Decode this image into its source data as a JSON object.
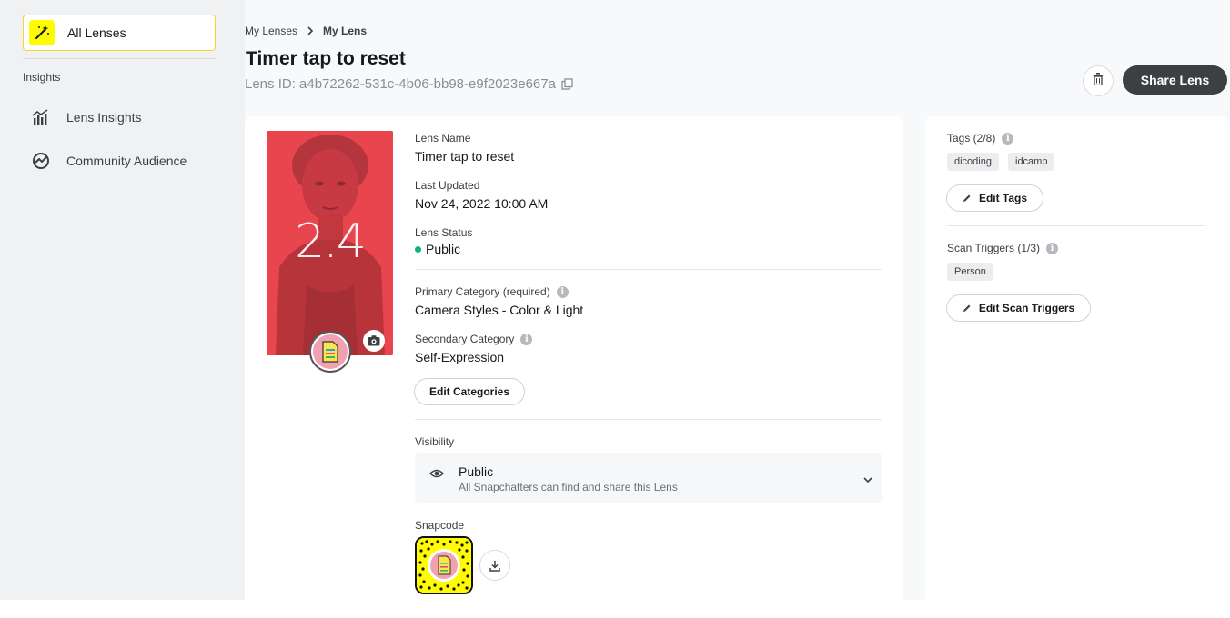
{
  "sidebar": {
    "all_lenses": "All Lenses",
    "section": "Insights",
    "items": [
      {
        "label": "Lens Insights",
        "icon": "bar-chart-icon"
      },
      {
        "label": "Community Audience",
        "icon": "trend-circle-icon"
      }
    ]
  },
  "breadcrumb": {
    "parent": "My Lenses",
    "current": "My Lens"
  },
  "header": {
    "title": "Timer tap to reset",
    "lens_id": "Lens ID: a4b72262-531c-4b06-bb98-e9f2023e667a",
    "share_label": "Share Lens"
  },
  "preview": {
    "overlay_text": "2.4",
    "bg_color": "#e8454f"
  },
  "details": {
    "lens_name_label": "Lens Name",
    "lens_name": "Timer tap to reset",
    "last_updated_label": "Last Updated",
    "last_updated": "Nov 24, 2022 10:00 AM",
    "status_label": "Lens Status",
    "status": "Public",
    "primary_category_label": "Primary Category (required)",
    "primary_category": "Camera Styles - Color & Light",
    "secondary_category_label": "Secondary Category",
    "secondary_category": "Self-Expression",
    "edit_categories": "Edit Categories",
    "visibility_label": "Visibility",
    "visibility_value": "Public",
    "visibility_desc": "All Snapchatters can find and share this Lens",
    "snapcode_label": "Snapcode"
  },
  "side": {
    "tags_label": "Tags (2/8)",
    "tags": [
      "dicoding",
      "idcamp"
    ],
    "edit_tags": "Edit Tags",
    "scan_triggers_label": "Scan Triggers (1/3)",
    "scan_triggers": [
      "Person"
    ],
    "edit_scan_triggers": "Edit Scan Triggers"
  },
  "colors": {
    "accent": "#fffc00",
    "status_public": "#10b27a",
    "primary_button": "#3c4043"
  }
}
